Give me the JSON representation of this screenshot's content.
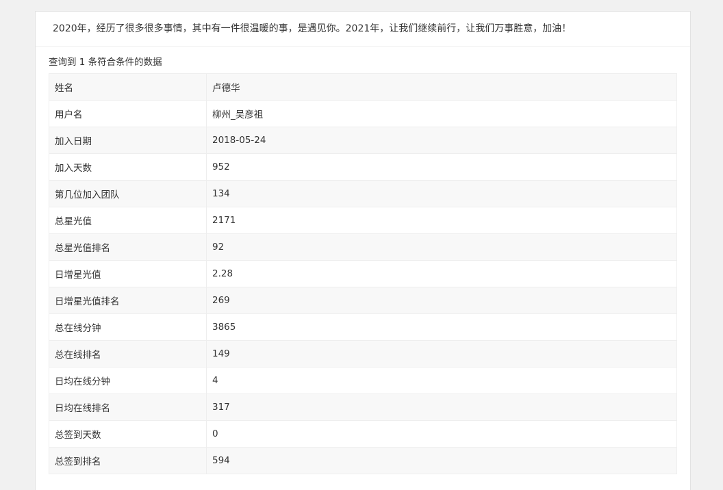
{
  "header": {
    "message": "2020年，经历了很多很多事情，其中有一件很温暖的事，是遇见你。2021年，让我们继续前行，让我们万事胜意，加油！"
  },
  "result": {
    "count_text": "查询到 1 条符合条件的数据"
  },
  "rows": [
    {
      "label": "姓名",
      "value": "卢德华"
    },
    {
      "label": "用户名",
      "value": "柳州_吴彦祖"
    },
    {
      "label": "加入日期",
      "value": "2018-05-24"
    },
    {
      "label": "加入天数",
      "value": "952"
    },
    {
      "label": "第几位加入团队",
      "value": "134"
    },
    {
      "label": "总星光值",
      "value": "2171"
    },
    {
      "label": "总星光值排名",
      "value": "92"
    },
    {
      "label": "日增星光值",
      "value": "2.28"
    },
    {
      "label": "日增星光值排名",
      "value": "269"
    },
    {
      "label": "总在线分钟",
      "value": "3865"
    },
    {
      "label": "总在线排名",
      "value": "149"
    },
    {
      "label": "日均在线分钟",
      "value": "4"
    },
    {
      "label": "日均在线排名",
      "value": "317"
    },
    {
      "label": "总签到天数",
      "value": "0"
    },
    {
      "label": "总签到排名",
      "value": "594"
    }
  ]
}
